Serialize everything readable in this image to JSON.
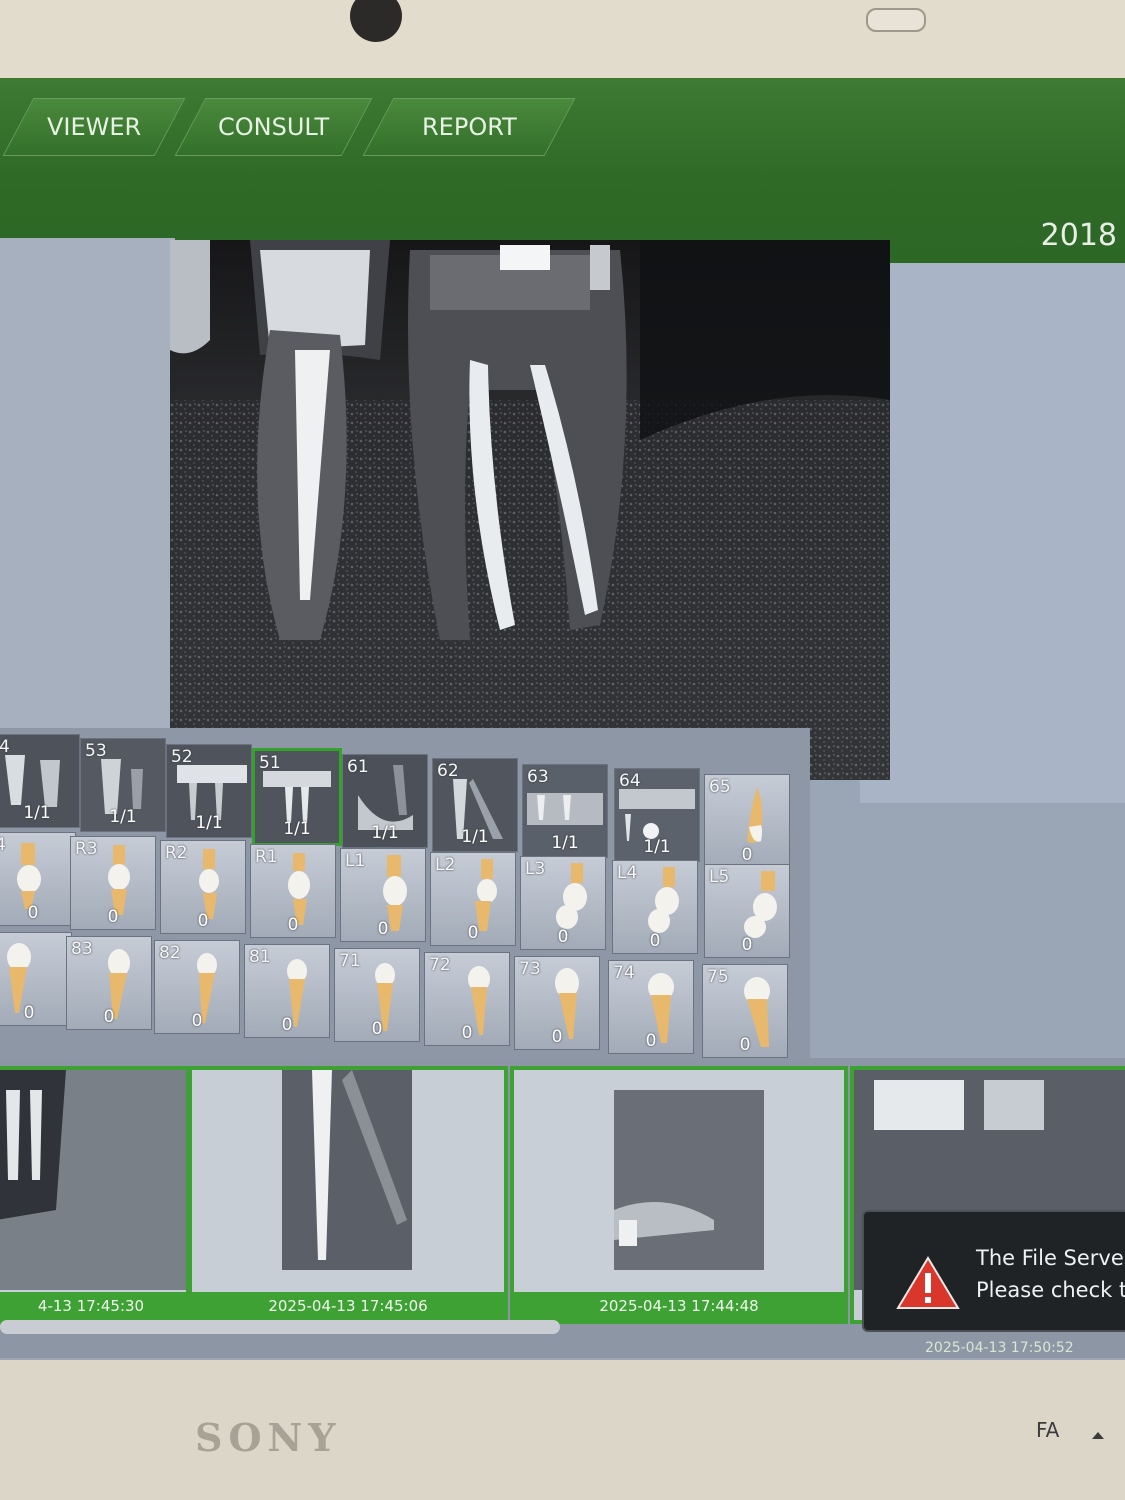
{
  "tabs": [
    "VIEWER",
    "CONSULT",
    "REPORT"
  ],
  "header_code": "2018",
  "thumbnails": [
    {
      "label": "4",
      "count": "1/1"
    },
    {
      "label": "53",
      "count": "1/1"
    },
    {
      "label": "52",
      "count": "1/1"
    },
    {
      "label": "51",
      "count": "1/1",
      "selected": true
    },
    {
      "label": "61",
      "count": "1/1"
    },
    {
      "label": "62",
      "count": "1/1"
    },
    {
      "label": "63",
      "count": "1/1"
    },
    {
      "label": "64",
      "count": "1/1"
    },
    {
      "label": "65",
      "count": "0"
    }
  ],
  "tooth_row_2": [
    {
      "label": "4",
      "count": "0"
    },
    {
      "label": "R3",
      "count": "0"
    },
    {
      "label": "R2",
      "count": "0"
    },
    {
      "label": "R1",
      "count": "0"
    },
    {
      "label": "L1",
      "count": "0"
    },
    {
      "label": "L2",
      "count": "0"
    },
    {
      "label": "L3",
      "count": "0"
    },
    {
      "label": "L4",
      "count": "0"
    },
    {
      "label": "L5",
      "count": "0"
    }
  ],
  "tooth_row_3": [
    {
      "label": "",
      "count": "0"
    },
    {
      "label": "83",
      "count": "0"
    },
    {
      "label": "82",
      "count": "0"
    },
    {
      "label": "81",
      "count": "0"
    },
    {
      "label": "71",
      "count": "0"
    },
    {
      "label": "72",
      "count": "0"
    },
    {
      "label": "73",
      "count": "0"
    },
    {
      "label": "74",
      "count": "0"
    },
    {
      "label": "75",
      "count": "0"
    }
  ],
  "timeline": [
    {
      "timestamp": "4-13 17:45:30"
    },
    {
      "timestamp": "2025-04-13 17:45:06"
    },
    {
      "timestamp": "2025-04-13 17:44:48"
    }
  ],
  "notification": {
    "line1": "The File Serve",
    "line2": "Please check t",
    "below": "2025-04-13 17:50:52"
  },
  "bezel": {
    "brand": "SONY",
    "indicator": "FA"
  },
  "colors": {
    "header_green": "#2f6a27",
    "selection_green": "#3da233",
    "warning_red": "#d9372b"
  }
}
